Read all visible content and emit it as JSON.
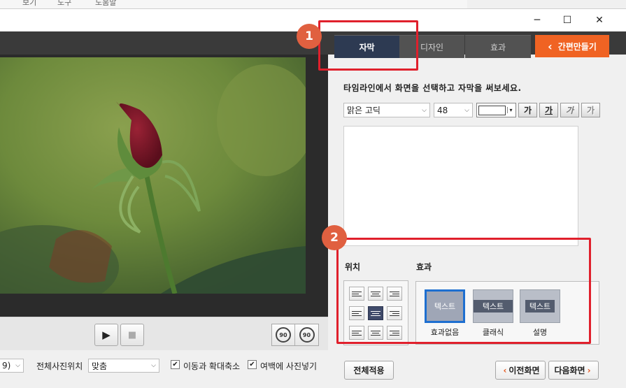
{
  "menubar": {
    "items": [
      "보기",
      "도구",
      "도움말"
    ]
  },
  "window": {
    "controls": {
      "minimize": "─",
      "maximize": "☐",
      "close": "✕"
    }
  },
  "player": {
    "play_icon": "▶",
    "stop_icon": "■",
    "rotate_ccw_label": "90",
    "rotate_cw_label": "90"
  },
  "bottom": {
    "left_select_value": "9)",
    "position_label": "전체사진위치",
    "position_value": "맞춤",
    "move_zoom_label": "이동과 확대축소",
    "move_zoom_checked": true,
    "margin_photo_label": "여백에 사진넣기",
    "margin_photo_checked": true
  },
  "tabs": [
    {
      "label": "자막",
      "active": true
    },
    {
      "label": "디자인",
      "active": false
    },
    {
      "label": "효과",
      "active": false
    }
  ],
  "quick_button": {
    "chevron": "‹",
    "label": "간편만들기"
  },
  "instruction": "타임라인에서 화면을 선택하고 자막을 써보세요.",
  "font": {
    "family_value": "맑은 고딕",
    "size_value": "48",
    "color_value": "#ffffff",
    "style_buttons": [
      "가",
      "가",
      "가",
      "가"
    ]
  },
  "position_section": {
    "title": "위치"
  },
  "effect_section": {
    "title": "효과",
    "items": [
      {
        "preview_text": "텍스트",
        "label": "효과없음",
        "selected": true
      },
      {
        "preview_text": "텍스트",
        "label": "클래식",
        "selected": false
      },
      {
        "preview_text": "텍스트",
        "label": "설명",
        "selected": false
      }
    ]
  },
  "apply_all_button": "전체적용",
  "prev_button": {
    "chevron": "‹",
    "label": "이전화면"
  },
  "next_button": {
    "chevron": "›",
    "label": "다음화면"
  },
  "annotations": {
    "marker1": "1",
    "marker2": "2"
  },
  "colors": {
    "accent": "#f06323",
    "active_tab": "#2d3a52",
    "annotation_red": "#e0202c"
  }
}
